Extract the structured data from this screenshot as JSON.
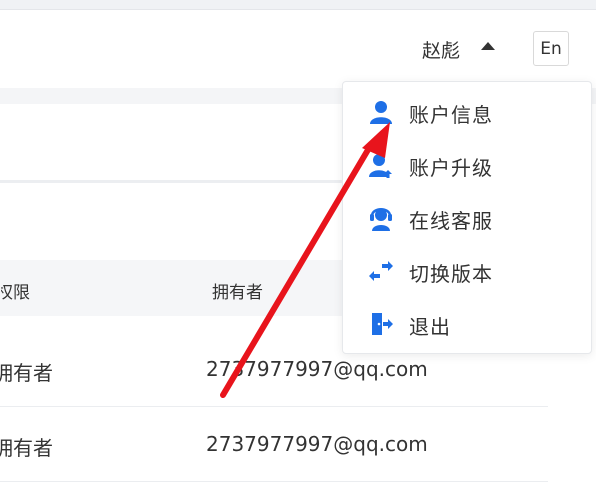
{
  "header": {
    "username": "赵彪",
    "language_button": "En"
  },
  "table": {
    "columns": [
      "权限",
      "拥有者"
    ],
    "rows": [
      {
        "permission": "拥有者",
        "owner": "2737977997@qq.com"
      },
      {
        "permission": "拥有者",
        "owner": "2737977997@qq.com"
      }
    ]
  },
  "dropdown": {
    "items": [
      {
        "label": "账户信息",
        "icon": "user-icon"
      },
      {
        "label": "账户升级",
        "icon": "user-upgrade-icon"
      },
      {
        "label": "在线客服",
        "icon": "customer-service-icon"
      },
      {
        "label": "切换版本",
        "icon": "switch-icon"
      },
      {
        "label": "退出",
        "icon": "logout-icon"
      }
    ]
  },
  "colors": {
    "icon_blue": "#1e6fe6",
    "annotation_arrow": "#e8141c"
  }
}
